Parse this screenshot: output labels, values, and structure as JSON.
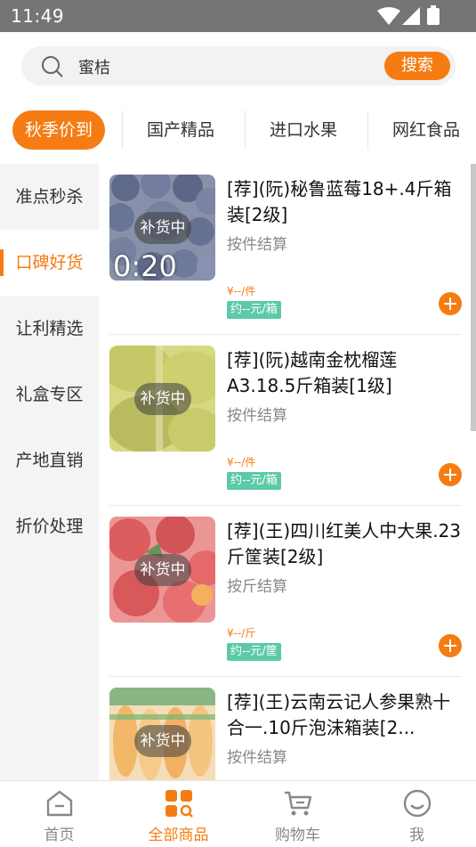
{
  "status_bar": {
    "time": "11:49"
  },
  "search": {
    "value": "蜜桔",
    "button": "搜索"
  },
  "category_tabs": [
    "秋季价到",
    "国产精品",
    "进口水果",
    "网红食品"
  ],
  "sidebar": [
    "准点秒杀",
    "口碑好货",
    "让利精选",
    "礼盒专区",
    "产地直销",
    "折价处理"
  ],
  "products": [
    {
      "title": "[荐](阮)秘鲁蓝莓18+.4斤箱装[2级]",
      "settle": "按件结算",
      "price": "¥--/件",
      "unit_price": "约--元/箱",
      "badge": "补货中",
      "timer": "0:20"
    },
    {
      "title": "[荐](阮)越南金枕榴莲A3.18.5斤箱装[1级]",
      "settle": "按件结算",
      "price": "¥--/件",
      "unit_price": "约--元/箱",
      "badge": "补货中"
    },
    {
      "title": "[荐](王)四川红美人中大果.23斤筐装[2级]",
      "settle": "按斤结算",
      "price": "¥--/斤",
      "unit_price": "约--元/筐",
      "badge": "补货中"
    },
    {
      "title": "[荐](王)云南云记人参果熟十合一.10斤泡沫箱装[2...",
      "settle": "按件结算",
      "badge": "补货中"
    }
  ],
  "bottom_nav": [
    "首页",
    "全部商品",
    "购物车",
    "我"
  ],
  "colors": {
    "accent": "#f57c12",
    "unit_tag": "#5cc9a8"
  }
}
